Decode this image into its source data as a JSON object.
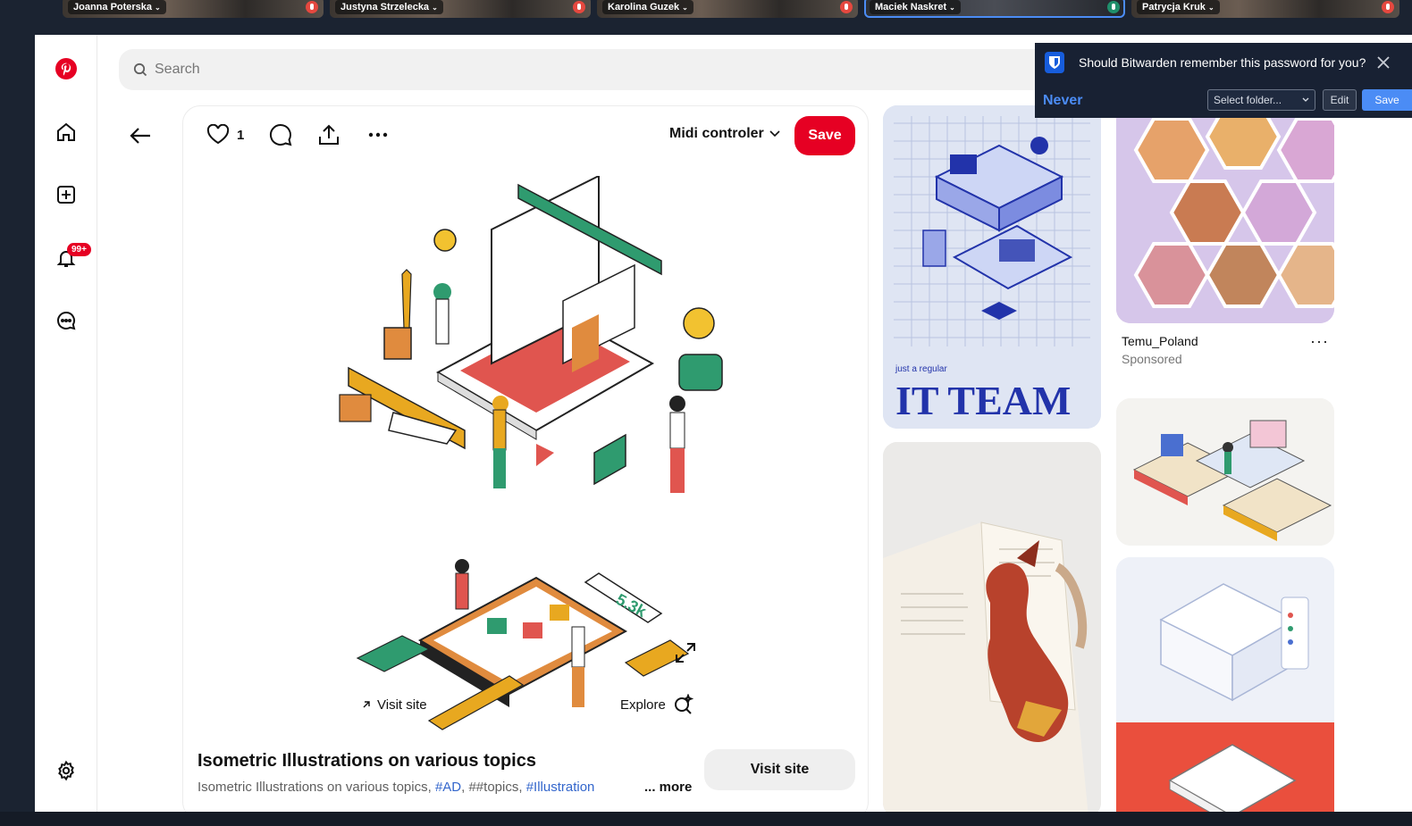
{
  "call": {
    "participants": [
      {
        "name": "Joanna Poterska",
        "muted": true
      },
      {
        "name": "Justyna Strzelecka",
        "muted": true
      },
      {
        "name": "Karolina Guzek",
        "muted": true
      },
      {
        "name": "Maciek Naskret",
        "muted": false,
        "active": true
      },
      {
        "name": "Patrycja Kruk",
        "muted": true
      }
    ]
  },
  "sidebar": {
    "items": [
      {
        "icon": "pinterest-logo-icon"
      },
      {
        "icon": "home-icon"
      },
      {
        "icon": "create-icon"
      },
      {
        "icon": "notifications-icon",
        "badge": "99+"
      },
      {
        "icon": "messages-icon"
      },
      {
        "icon": "settings-icon"
      }
    ]
  },
  "search": {
    "placeholder": "Search"
  },
  "pin": {
    "like_count": "1",
    "board": "Midi controler",
    "save_label": "Save",
    "title": "Isometric Illustrations on various topics",
    "description_text": "Isometric Illustrations on various topics, ",
    "tags": [
      "#AD",
      "##topics",
      "#Illustration"
    ],
    "more_label": "... more",
    "visit_site_label": "Visit site",
    "overlay_visit_label": "Visit site",
    "overlay_explore_label": "Explore"
  },
  "feed": {
    "it_team_small": "just a regular",
    "it_team_title": "IT TEAM",
    "promo_name": "Temu_Poland",
    "promo_label": "Sponsored",
    "promo_more": "···"
  },
  "bitwarden": {
    "message": "Should Bitwarden remember this password for you?",
    "never_label": "Never",
    "folder_placeholder": "Select folder...",
    "edit_label": "Edit",
    "save_label": "Save"
  },
  "colors": {
    "brand_red": "#e60023",
    "bitwarden_bg": "#182133",
    "bitwarden_blue": "#4b8cf5",
    "tag_link": "#3366cc"
  }
}
